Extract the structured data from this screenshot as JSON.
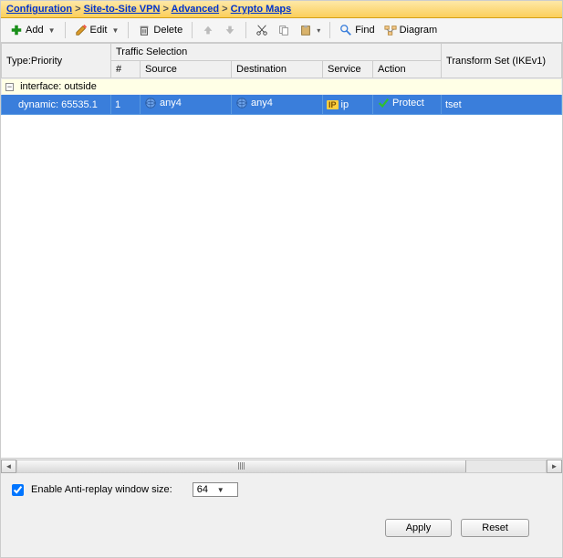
{
  "breadcrumb": {
    "configuration": "Configuration",
    "vpn": "Site-to-Site VPN",
    "advanced": "Advanced",
    "crypto": "Crypto Maps"
  },
  "toolbar": {
    "add": "Add",
    "edit": "Edit",
    "delete": "Delete",
    "find": "Find",
    "diagram": "Diagram"
  },
  "headers": {
    "type_priority": "Type:Priority",
    "traffic_selection": "Traffic Selection",
    "num": "#",
    "source": "Source",
    "destination": "Destination",
    "service": "Service",
    "action": "Action",
    "transform": "Transform Set (IKEv1)"
  },
  "group": {
    "label": "interface: outside"
  },
  "row": {
    "type_priority": "dynamic: 65535.1",
    "num": "1",
    "source": "any4",
    "destination": "any4",
    "service": "ip",
    "action": "Protect",
    "transform": "tset"
  },
  "footer": {
    "antireplay": "Enable Anti-replay window size:",
    "antireplay_value": "64",
    "apply": "Apply",
    "reset": "Reset"
  }
}
